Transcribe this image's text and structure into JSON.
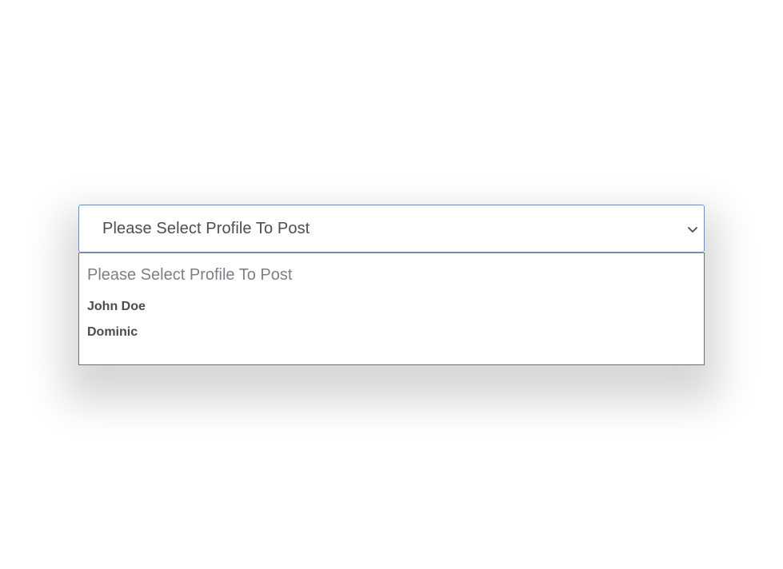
{
  "profile_select": {
    "selected_label": "Please Select Profile To Post",
    "icon": "chevron-down-icon",
    "accent_color": "#5b8fe0",
    "options": [
      {
        "label": "Please Select Profile To Post",
        "is_placeholder": true
      },
      {
        "label": "John Doe"
      },
      {
        "label": "Dominic"
      }
    ]
  }
}
